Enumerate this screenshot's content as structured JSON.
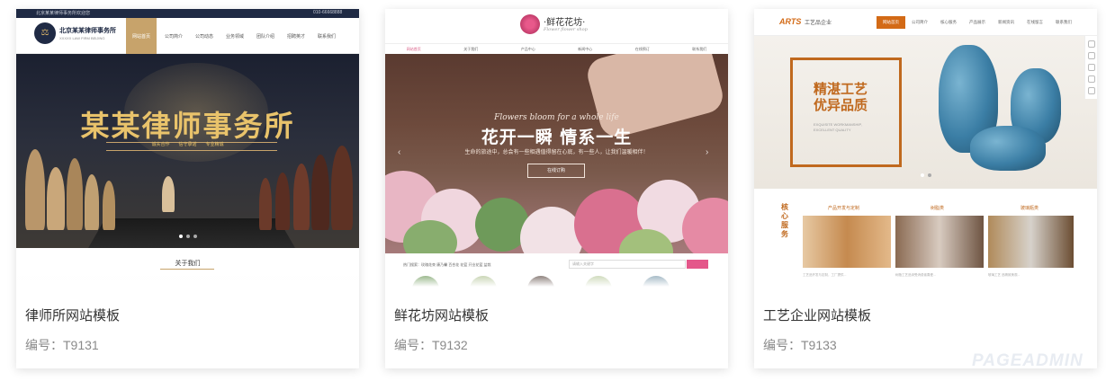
{
  "cards": [
    {
      "title": "律师所网站模板",
      "code": "编号：T9131",
      "thumb": {
        "topbar_left": "北京某某律师事务所欢迎您",
        "topbar_right": "010-66668888",
        "brand": "北京某某律师事务所",
        "brand_sub": "XXXXX LAW FIRM BEIJING",
        "nav": [
          "网站首页",
          "公司简介",
          "公司动态",
          "业务领域",
          "团队介绍",
          "招聘英才",
          "联系我们"
        ],
        "hero_title": "某某律师事务所",
        "hero_sub": "诚实合作　　信守承诺　　专业精诚",
        "about": "关于我们"
      }
    },
    {
      "title": "鲜花坊网站模板",
      "code": "编号：T9132",
      "thumb": {
        "logo": "·鲜花花坊·",
        "logo_sub": "Flower flower shop",
        "nav": [
          "网站首页",
          "关于我们",
          "产品中心",
          "新闻中心",
          "在线预订",
          "联系我们"
        ],
        "hero_en": "Flowers bloom for a whole life",
        "hero_title": "花开一瞬  情系一生",
        "hero_sub": "生命的旅途中，总会有一些相遇值得留在心底，有一些人，让我们温暖相伴！",
        "hero_button": "在线订购",
        "hot_search": "热门搜索：玫瑰花束  康乃馨  百合花  花篮  开业花篮  盆栽",
        "search_placeholder": "请输入关键字"
      }
    },
    {
      "title": "工艺企业网站模板",
      "code": "编号：T9133",
      "thumb": {
        "logo": "ARTS",
        "logo_name": "工艺品企业",
        "nav": [
          "网站首页",
          "公司简介",
          "核心服务",
          "产品展示",
          "新闻资讯",
          "在线留言",
          "联系我们"
        ],
        "hero_title_1": "精湛工艺",
        "hero_title_2": "优异品质",
        "hero_sub_1": "EXQUISITE WORKMANSHIP,",
        "hero_sub_2": "EXCELLENT QUALITY",
        "section_title": "核心服务",
        "categories": [
          "产品开发与定制",
          "树脂类",
          "玻璃瓶类"
        ],
        "captions": [
          "工艺品开发与定制，工厂提供...",
          "树脂工艺品深受消费者喜爱...",
          "玻璃工艺 品精致美观..."
        ]
      }
    }
  ],
  "watermark": "PAGEADMIN"
}
